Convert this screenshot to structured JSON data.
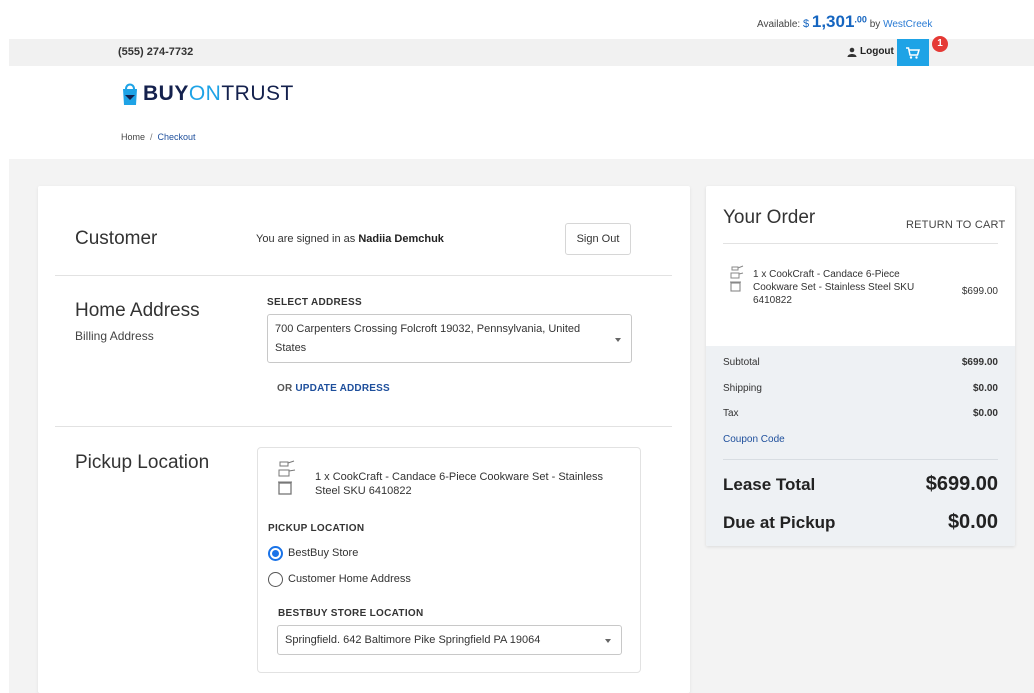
{
  "header": {
    "available_label": "Available:",
    "currency": "$",
    "amount": "1,301",
    "cents": ".00",
    "by_label": "by",
    "lender": "WestCreek",
    "phone": "(555) 274-7732",
    "logout_label": "Logout",
    "cart_count": "1"
  },
  "brand": {
    "part1": "BUY",
    "part2": "ON",
    "part3": "TRUST"
  },
  "breadcrumb": [
    "Home",
    "/",
    "Checkout"
  ],
  "customer": {
    "title": "Customer",
    "signed_in_prefix": "You are signed in as",
    "name": "Nadiia Demchuk",
    "sign_out_label": "Sign Out"
  },
  "address": {
    "title": "Home Address",
    "subtitle": "Billing Address",
    "select_label": "SELECT ADDRESS",
    "selected_line1": "700 Carpenters Crossing Folcroft 19032, Pennsylvania, United",
    "selected_line2": "States",
    "or_label": "OR",
    "update_label": "UPDATE ADDRESS"
  },
  "pickup": {
    "title": "Pickup Location",
    "item_text": "1 x CookCraft - Candace 6-Piece Cookware Set - Stainless Steel SKU 6410822",
    "location_label": "PICKUP LOCATION",
    "options": [
      {
        "label": "BestBuy Store",
        "selected": true
      },
      {
        "label": "Customer Home Address",
        "selected": false
      }
    ],
    "store_label": "BESTBUY STORE LOCATION",
    "store_value": "Springfield. 642 Baltimore Pike Springfield PA 19064"
  },
  "order": {
    "title": "Your Order",
    "return_label": "RETURN TO CART",
    "item_text": "1 x CookCraft - Candace 6-Piece Cookware Set - Stainless Steel SKU 6410822",
    "item_price": "$699.00",
    "rows": [
      {
        "label": "Subtotal",
        "value": "$699.00"
      },
      {
        "label": "Shipping",
        "value": "$0.00"
      },
      {
        "label": "Tax",
        "value": "$0.00"
      }
    ],
    "coupon_label": "Coupon Code",
    "lease_total_label": "Lease Total",
    "lease_total_value": "$699.00",
    "due_label": "Due at Pickup",
    "due_value": "$0.00"
  },
  "colors": {
    "accent_blue": "#1ea3e6",
    "link_blue": "#1e4f9c",
    "brand_navy": "#14214d",
    "badge_red": "#e53935"
  }
}
